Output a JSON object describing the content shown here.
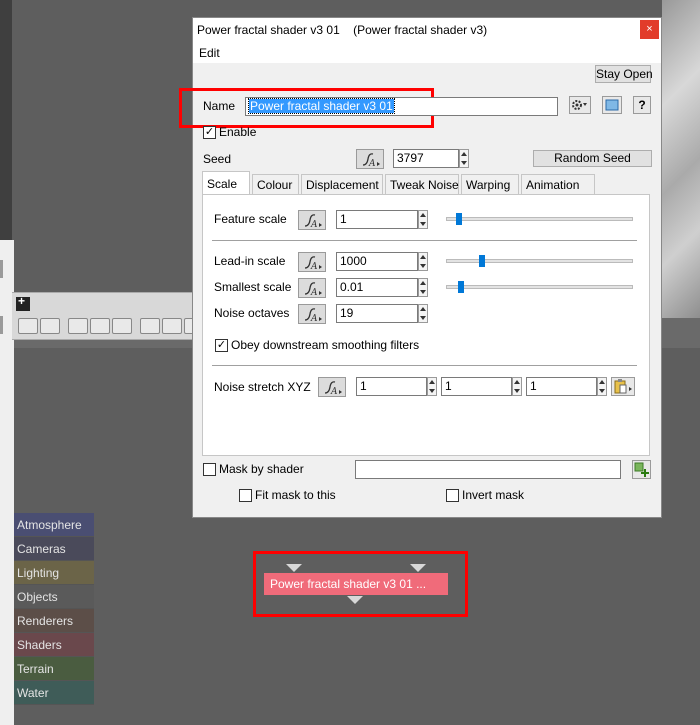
{
  "dialog": {
    "title": "Power fractal shader v3 01    (Power fractal shader v3)",
    "close_glyph": "×",
    "menu": {
      "edit": "Edit"
    },
    "stay_open_label": "Stay Open",
    "name_label": "Name",
    "name_value": "Power fractal shader v3 01",
    "help_label": "?",
    "enable_label": "Enable",
    "seed_label": "Seed",
    "seed_value": "3797",
    "random_seed_label": "Random Seed",
    "tabs": [
      "Scale",
      "Colour",
      "Displacement",
      "Tweak Noise",
      "Warping",
      "Animation"
    ],
    "active_tab": "Scale",
    "scale": {
      "feature_scale_label": "Feature scale",
      "feature_scale_value": "1",
      "feature_scale_slider": 0.05,
      "lead_in_label": "Lead-in scale",
      "lead_in_value": "1000",
      "lead_in_slider": 0.18,
      "smallest_label": "Smallest scale",
      "smallest_value": "0.01",
      "smallest_slider": 0.06,
      "octaves_label": "Noise octaves",
      "octaves_value": "19",
      "obey_label": "Obey downstream smoothing filters",
      "stretch_label": "Noise stretch XYZ",
      "stretch_x": "1",
      "stretch_y": "1",
      "stretch_z": "1"
    },
    "mask_label": "Mask by shader",
    "mask_value": "",
    "fit_mask_label": "Fit mask to this",
    "invert_mask_label": "Invert mask",
    "checked_glyph": "✓"
  },
  "categories": [
    {
      "label": "Atmosphere",
      "color": "#4a4e72"
    },
    {
      "label": "Cameras",
      "color": "#4a4a5a"
    },
    {
      "label": "Lighting",
      "color": "#6b6448"
    },
    {
      "label": "Objects",
      "color": "#5a5a5a"
    },
    {
      "label": "Renderers",
      "color": "#5c4e48"
    },
    {
      "label": "Shaders",
      "color": "#6a484c"
    },
    {
      "label": "Terrain",
      "color": "#4a5c40"
    },
    {
      "label": "Water",
      "color": "#3f5c58"
    }
  ],
  "node": {
    "label": "Power fractal shader v3 01 ...",
    "color": "#f06b7a"
  },
  "accent_red": "#ff0000"
}
